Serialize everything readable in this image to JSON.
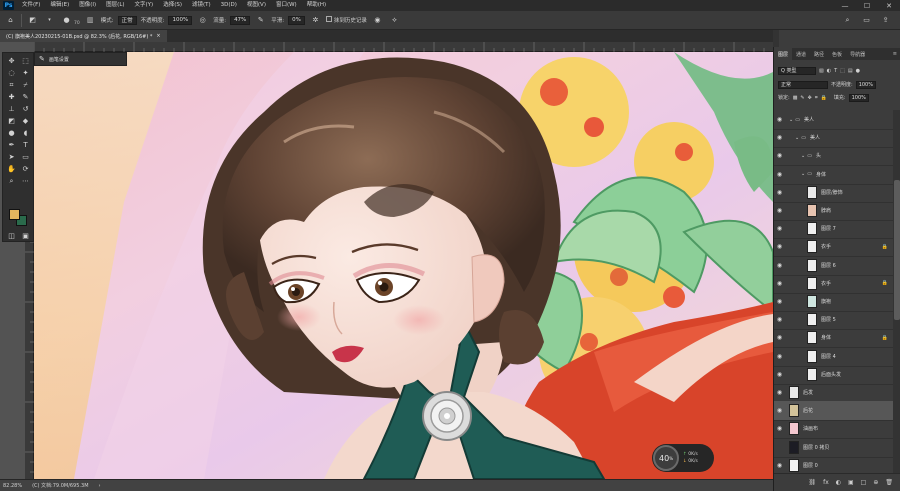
{
  "app": {
    "logo_text": "Ps",
    "menu": [
      "文件(F)",
      "编辑(E)",
      "图像(I)",
      "图层(L)",
      "文字(Y)",
      "选择(S)",
      "滤镜(T)",
      "3D(D)",
      "视图(V)",
      "窗口(W)",
      "帮助(H)"
    ],
    "window_controls": [
      "—",
      "☐",
      "✕"
    ]
  },
  "options": {
    "brush_size": "70",
    "mode_label": "模式:",
    "mode_value": "正常",
    "opacity_label": "不透明度:",
    "opacity_value": "100%",
    "flow_label": "流量:",
    "flow_value": "47%",
    "smooth_label": "平滑:",
    "smooth_value": "0%",
    "history_label": "抹到历史记录"
  },
  "document": {
    "tab_title": "(C) 旗袍美人20230215-01B.psd @ 82.3% (后花, RGB/16#) *",
    "tab_close": "×",
    "zoom": "82.28%",
    "doc_info": "(C) 文档:79.0M/695.3M",
    "status_arrow": "›"
  },
  "brush_popup": {
    "label": "画笔设置"
  },
  "perf": {
    "value": "40",
    "unit": "%",
    "up": "0",
    "up_unit": "K/s",
    "down": "0",
    "down_unit": "K/s"
  },
  "panel": {
    "tabs": [
      "图层",
      "通道",
      "路径",
      "色板",
      "导航器"
    ],
    "filter_label": "Q 类型",
    "blend_mode": "正常",
    "opacity_label": "不透明度:",
    "opacity_value": "100%",
    "lock_label": "锁定:",
    "fill_label": "填充:",
    "fill_value": "100%",
    "menu_icon": "≡"
  },
  "layers": [
    {
      "name": "美人",
      "type": "group",
      "indent": 0,
      "thumb": "#3a3a3a",
      "visible": true
    },
    {
      "name": "美人",
      "type": "group",
      "indent": 1,
      "thumb": "#3a3a3a",
      "visible": true
    },
    {
      "name": "头",
      "type": "group",
      "indent": 2,
      "thumb": "#3a3a3a",
      "visible": true
    },
    {
      "name": "身体",
      "type": "group",
      "indent": 2,
      "thumb": "#3a3a3a",
      "visible": true
    },
    {
      "name": "图层/脖饰",
      "type": "layer",
      "indent": 3,
      "thumb": "#e9e9e9",
      "visible": true
    },
    {
      "name": "脖肩",
      "type": "layer",
      "indent": 3,
      "thumb": "#e7c3b0",
      "visible": true
    },
    {
      "name": "图层 7",
      "type": "layer",
      "indent": 3,
      "thumb": "#efefef",
      "visible": true,
      "locked": false
    },
    {
      "name": "衣手",
      "type": "layer",
      "indent": 3,
      "thumb": "#efefef",
      "visible": true,
      "locked": true
    },
    {
      "name": "图层 6",
      "type": "layer",
      "indent": 3,
      "thumb": "#efefef",
      "visible": true
    },
    {
      "name": "衣手",
      "type": "layer",
      "indent": 3,
      "thumb": "#efefef",
      "visible": true,
      "locked": true
    },
    {
      "name": "旗袍",
      "type": "layer",
      "indent": 3,
      "thumb": "#cfe6e0",
      "visible": true
    },
    {
      "name": "图层 5",
      "type": "layer",
      "indent": 3,
      "thumb": "#efefef",
      "visible": true
    },
    {
      "name": "身体",
      "type": "layer",
      "indent": 3,
      "thumb": "#efefef",
      "visible": true,
      "locked": true
    },
    {
      "name": "图层 4",
      "type": "layer",
      "indent": 3,
      "thumb": "#efefef",
      "visible": true
    },
    {
      "name": "后面头发",
      "type": "layer",
      "indent": 3,
      "thumb": "#efefef",
      "visible": true
    },
    {
      "name": "后发",
      "type": "layer",
      "indent": 0,
      "thumb": "#e8e8e8",
      "visible": true
    },
    {
      "name": "后花",
      "type": "layer",
      "indent": 0,
      "thumb": "#d3c39a",
      "visible": true,
      "selected": true
    },
    {
      "name": "油画布",
      "type": "layer",
      "indent": 0,
      "thumb": "#f4c7cf",
      "visible": true
    },
    {
      "name": "图层 0 拷贝",
      "type": "layer",
      "indent": 0,
      "thumb": "#1c1c24",
      "visible": false
    },
    {
      "name": "图层 0",
      "type": "layer",
      "indent": 0,
      "thumb": "#f4f4f4",
      "visible": true
    }
  ],
  "panel_bottom_icons": [
    "fx",
    "◐",
    "▣",
    "□",
    "🗀",
    "⊕",
    "🗑"
  ]
}
